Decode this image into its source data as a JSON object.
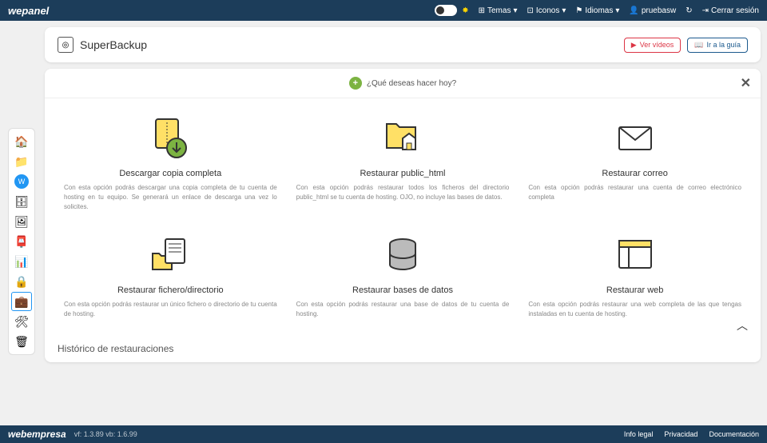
{
  "header": {
    "brand": "wepanel",
    "themes": "Temas",
    "icons": "Iconos",
    "languages": "Idiomas",
    "user": "pruebasw",
    "logout": "Cerrar sesión"
  },
  "title": {
    "text": "SuperBackup",
    "videos": "Ver vídeos",
    "guide": "Ir a la guía"
  },
  "prompt": "¿Qué deseas hacer hoy?",
  "items": [
    {
      "title": "Descargar copia completa",
      "desc": "Con esta opción podrás descargar una copia completa de tu cuenta de hosting en tu equipo. Se generará un enlace de descarga una vez lo solicites."
    },
    {
      "title": "Restaurar public_html",
      "desc": "Con esta opción podrás restaurar todos los ficheros del directorio public_html se tu cuenta de hosting. OJO, no incluye las bases de datos."
    },
    {
      "title": "Restaurar correo",
      "desc": "Con esta opción podrás restaurar una cuenta de correo electrónico completa"
    },
    {
      "title": "Restaurar fichero/directorio",
      "desc": "Con esta opción podrás restaurar un único fichero o directorio de tu cuenta de hosting."
    },
    {
      "title": "Restaurar bases de datos",
      "desc": "Con esta opción podrás restaurar una base de datos de tu cuenta de hosting."
    },
    {
      "title": "Restaurar web",
      "desc": "Con esta opción podrás restaurar una web completa de las que tengas instaladas en tu cuenta de hosting."
    }
  ],
  "history": "Histórico de restauraciones",
  "footer": {
    "brand": "webempresa",
    "version": "vf: 1.3.89 vb: 1.6.99",
    "legal": "Info legal",
    "privacy": "Privacidad",
    "docs": "Documentación"
  }
}
